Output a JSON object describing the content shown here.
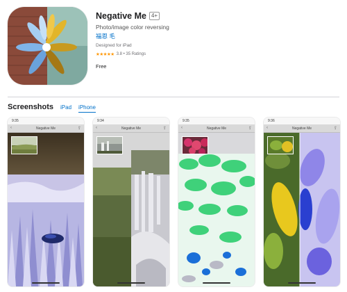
{
  "app": {
    "title": "Negative Me",
    "age_rating": "4+",
    "subtitle": "Photo/image color reversing",
    "developer": "福恩 毛",
    "designed_for": "Designed for iPad",
    "stars": "★★★★★",
    "rating_text": "3.8 • 35 Ratings",
    "price": "Free"
  },
  "screenshots": {
    "title": "Screenshots",
    "tabs": [
      {
        "label": "iPad",
        "active": false
      },
      {
        "label": "iPhone",
        "active": true
      }
    ],
    "items": [
      {
        "time": "9:35",
        "nav_title": "Negative Me"
      },
      {
        "time": "9:34",
        "nav_title": "Negative Me"
      },
      {
        "time": "9:35",
        "nav_title": "Negative Me"
      },
      {
        "time": "9:36",
        "nav_title": "Negative Me"
      }
    ]
  },
  "icons": {
    "back": "chevron-left-icon",
    "share": "share-icon"
  },
  "colors": {
    "link": "#0070c9",
    "star": "#ff9500",
    "text": "#1d1d1f",
    "secondary_text": "#6e6e73"
  }
}
